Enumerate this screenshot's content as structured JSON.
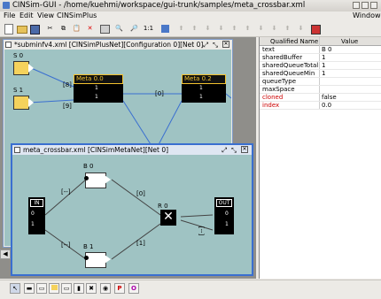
{
  "window": {
    "title": "CINSim-GUI - /home/kuehmi/workspace/gui-trunk/samples/meta_crossbar.xml"
  },
  "menu": {
    "file": "File",
    "edit": "Edit",
    "view": "View",
    "cinsimplus": "CINSimPlus",
    "window": "Window"
  },
  "toolbar": {
    "zoom_label": "1:1"
  },
  "outer_frame": {
    "title": "*subminfv4.xml [CINSimPlusNet][Configuration 0][Net 0]",
    "nodes": {
      "s0": "S 0",
      "s1": "S 1",
      "meta0": "Meta 0.0",
      "meta2": "Meta 0.2"
    },
    "edges": {
      "e8": "[8]",
      "e9": "[9]",
      "e0": "[0]"
    },
    "port_label": "1"
  },
  "inner_frame": {
    "title": "meta_crossbar.xml [CINSimMetaNet][Net 0]",
    "nodes": {
      "in": "IN",
      "out": "OUT",
      "b0": "B 0",
      "b1": "B 1",
      "r0": "R 0"
    },
    "edges": {
      "left_top": "[--]",
      "left_bot": "[--]",
      "mid_top": "[0]",
      "mid_bot": "[1]",
      "right": "[--]"
    },
    "ports": {
      "p0": "0",
      "p1": "1"
    }
  },
  "properties": {
    "headers": {
      "name": "Qualified Name",
      "value": "Value"
    },
    "rows": [
      {
        "name": "text",
        "value": "B 0",
        "color": "#000000"
      },
      {
        "name": "sharedBuffer",
        "value": "1",
        "color": "#000000"
      },
      {
        "name": "sharedQueueTotal",
        "value": "1",
        "color": "#000000"
      },
      {
        "name": "sharedQueueMin",
        "value": "1",
        "color": "#000000"
      },
      {
        "name": "queueType",
        "value": "",
        "color": "#000000"
      },
      {
        "name": "maxSpace",
        "value": "",
        "color": "#000000"
      },
      {
        "name": "cloned",
        "value": "false",
        "color": "#cc0000"
      },
      {
        "name": "index",
        "value": "0.0",
        "color": "#cc0000"
      }
    ]
  },
  "colors": {
    "canvas": "#9fc3c3",
    "accent": "#3a6fd0",
    "meta_border": "#f2c12e",
    "yellow": "#f5d25c"
  }
}
